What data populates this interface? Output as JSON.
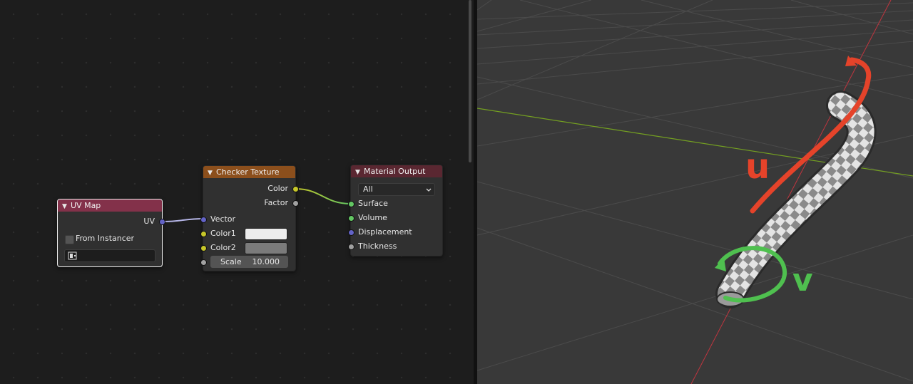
{
  "nodes": {
    "uv_map": {
      "title": "UV Map",
      "output_uv": "UV",
      "from_instancer_label": "From Instancer",
      "from_instancer_checked": false,
      "uv_map_value": ""
    },
    "checker_texture": {
      "title": "Checker Texture",
      "output_color": "Color",
      "output_factor": "Factor",
      "input_vector": "Vector",
      "input_color1": "Color1",
      "input_color2": "Color2",
      "input_scale": "Scale",
      "scale_value": "10.000",
      "color1_swatch": "#ececec",
      "color2_swatch": "#7b7b7b"
    },
    "material_output": {
      "title": "Material Output",
      "target": "All",
      "input_surface": "Surface",
      "input_volume": "Volume",
      "input_displacement": "Displacement",
      "input_thickness": "Thickness"
    }
  },
  "viewport": {
    "annotation_u": "u",
    "annotation_v": "v",
    "annotation_u_color": "#e5432a",
    "annotation_v_color": "#4fc04f"
  },
  "colors": {
    "uv_header": "#83314a",
    "texture_header": "#8c4f1c",
    "output_header": "#5a2731",
    "x_axis": "#c0353f",
    "y_axis": "#74a021"
  }
}
